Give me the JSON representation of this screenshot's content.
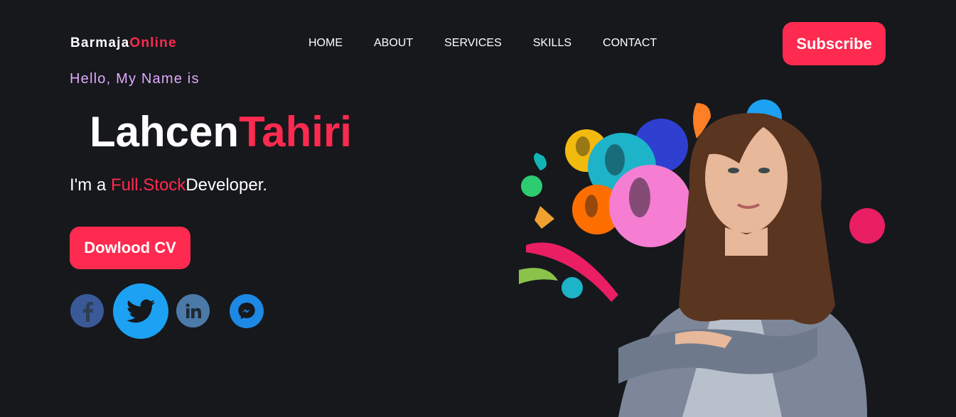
{
  "header": {
    "logo_part1": "Barmaja",
    "logo_part2": "Online",
    "nav": [
      "HOME",
      "ABOUT",
      "SERVICES",
      "SKILLS",
      "CONTACT"
    ],
    "subscribe_label": "Subscribe"
  },
  "hero": {
    "greeting": "Hello, My Name is",
    "first_name": "Lahcen",
    "last_name": "Tahiri",
    "role_prefix": "I'm a ",
    "role_highlight": "Full.Stock",
    "role_suffix": "Developer.",
    "cv_button": "Dowlood CV"
  },
  "social": [
    "facebook-icon",
    "twitter-icon",
    "linkedin-icon",
    "messenger-icon"
  ],
  "colors": {
    "accent": "#ff2a4f",
    "background": "#16181c",
    "greeting": "#e0a8ff"
  }
}
